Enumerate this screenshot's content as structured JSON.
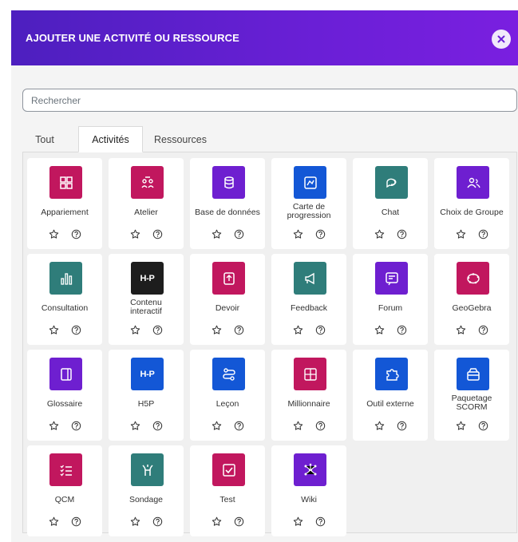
{
  "modal": {
    "title": "AJOUTER UNE ACTIVITÉ OU RESSOURCE",
    "search_placeholder": "Rechercher"
  },
  "tabs": [
    {
      "label": "Tout",
      "active": false
    },
    {
      "label": "Activités",
      "active": true
    },
    {
      "label": "Ressources",
      "active": false
    }
  ],
  "colors": {
    "header_gradient_start": "#4d1fbf",
    "header_gradient_end": "#7a1fe0",
    "pink": "#c1175e",
    "purple": "#6e1fd0",
    "blue": "#1357d6",
    "teal": "#2f7d7a",
    "black": "#1d1d1d"
  },
  "activities": [
    {
      "label": "Appariement",
      "icon": "matching-icon",
      "color": "#c1175e"
    },
    {
      "label": "Atelier",
      "icon": "workshop-icon",
      "color": "#c1175e"
    },
    {
      "label": "Base de données",
      "icon": "database-icon",
      "color": "#6e1fd0"
    },
    {
      "label": "Carte de\nprogression",
      "icon": "map-icon",
      "color": "#1357d6"
    },
    {
      "label": "Chat",
      "icon": "chat-icon",
      "color": "#2f7d7a"
    },
    {
      "label": "Choix de Groupe",
      "icon": "group-icon",
      "color": "#6e1fd0"
    },
    {
      "label": "Consultation",
      "icon": "chart-icon",
      "color": "#2f7d7a"
    },
    {
      "label": "Contenu\ninteractif",
      "icon": "h5p-icon",
      "color": "#1d1d1d"
    },
    {
      "label": "Devoir",
      "icon": "assignment-icon",
      "color": "#c1175e"
    },
    {
      "label": "Feedback",
      "icon": "megaphone-icon",
      "color": "#2f7d7a"
    },
    {
      "label": "Forum",
      "icon": "forum-icon",
      "color": "#6e1fd0"
    },
    {
      "label": "GeoGebra",
      "icon": "geogebra-icon",
      "color": "#c1175e"
    },
    {
      "label": "Glossaire",
      "icon": "glossary-icon",
      "color": "#6e1fd0"
    },
    {
      "label": "H5P",
      "icon": "h5p-icon",
      "color": "#1357d6"
    },
    {
      "label": "Leçon",
      "icon": "lesson-icon",
      "color": "#1357d6"
    },
    {
      "label": "Millionnaire",
      "icon": "millionaire-icon",
      "color": "#c1175e"
    },
    {
      "label": "Outil externe",
      "icon": "puzzle-icon",
      "color": "#1357d6"
    },
    {
      "label": "Paquetage\nSCORM",
      "icon": "package-icon",
      "color": "#1357d6"
    },
    {
      "label": "QCM",
      "icon": "quiz-list-icon",
      "color": "#c1175e"
    },
    {
      "label": "Sondage",
      "icon": "survey-icon",
      "color": "#2f7d7a"
    },
    {
      "label": "Test",
      "icon": "checkbox-icon",
      "color": "#c1175e"
    },
    {
      "label": "Wiki",
      "icon": "wiki-icon",
      "color": "#6e1fd0"
    }
  ],
  "h5p_text": "H-P"
}
